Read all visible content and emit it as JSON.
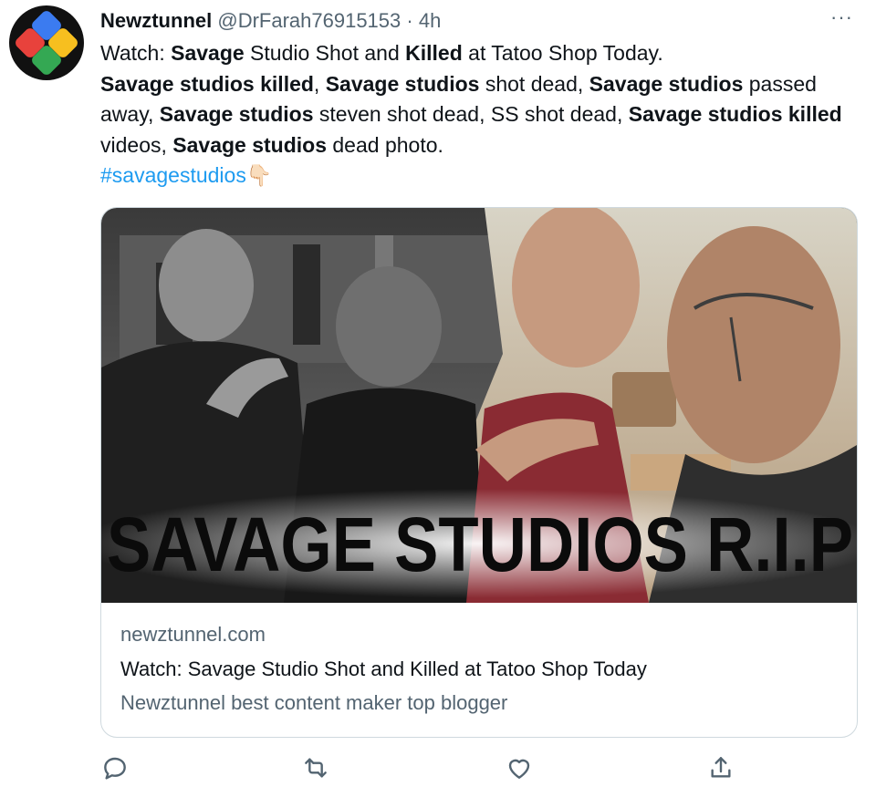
{
  "tweet": {
    "display_name": "Newztunnel",
    "handle": "@DrFarah76915153",
    "time": "4h",
    "more_label": "···",
    "hashtag": "#savagestudios",
    "emoji": "👇🏻"
  },
  "text_segments": {
    "p1": "Watch: ",
    "p2": "Savage",
    "p3": " Studio Shot and ",
    "p4": "Killed",
    "p5": " at Tatoo Shop Today.",
    "p6": "Savage studios killed",
    "p7": ", ",
    "p8": "Savage studios",
    "p9": " shot dead, ",
    "p10": "Savage studios",
    "p11": " passed away, ",
    "p12": "Savage studios",
    "p13": " steven shot dead, SS shot dead, ",
    "p14": "Savage studios killed",
    "p15": " videos, ",
    "p16": "Savage studios",
    "p17": " dead photo."
  },
  "card": {
    "image_caption": "SAVAGE STUDIOS R.I.P",
    "domain": "newztunnel.com",
    "title": "Watch: Savage Studio Shot and Killed at Tatoo Shop Today",
    "description": "Newztunnel best content maker top blogger"
  },
  "icons": [
    "reply-icon",
    "retweet-icon",
    "like-icon",
    "share-icon",
    "more-icon",
    "pointing-down-emoji"
  ],
  "colors": {
    "link": "#1d9bf0",
    "secondary_text": "#536471",
    "border": "#cfd9de",
    "avatar_blue": "#3b7bf0",
    "avatar_red": "#e8423c",
    "avatar_yellow": "#f7bf1f",
    "avatar_green": "#34a853"
  }
}
